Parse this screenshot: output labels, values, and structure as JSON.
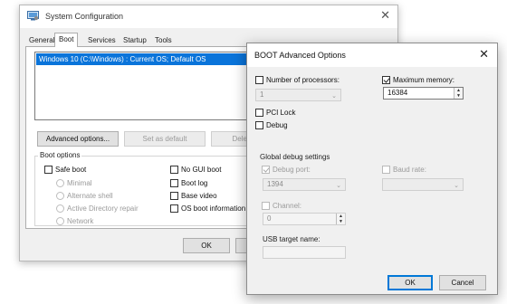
{
  "syscfg": {
    "title": "System Configuration",
    "tabs": [
      "General",
      "Boot",
      "Services",
      "Startup",
      "Tools"
    ],
    "os_entries": [
      "Windows 10 (C:\\Windows) : Current OS; Default OS"
    ],
    "buttons": {
      "advanced": "Advanced options...",
      "set_default": "Set as default",
      "delete": "Delete",
      "ok": "OK"
    },
    "boot_options": {
      "legend": "Boot options",
      "safe_boot": "Safe boot",
      "minimal": "Minimal",
      "alternate_shell": "Alternate shell",
      "active_directory_repair": "Active Directory repair",
      "network": "Network",
      "no_gui_boot": "No GUI boot",
      "boot_log": "Boot log",
      "base_video": "Base video",
      "os_boot_information": "OS boot information"
    }
  },
  "advanced": {
    "title": "BOOT Advanced Options",
    "num_processors": {
      "label": "Number of processors:",
      "checked": false,
      "value": "1"
    },
    "max_memory": {
      "label": "Maximum memory:",
      "checked": true,
      "value": "16384"
    },
    "pci_lock": {
      "label": "PCI Lock",
      "checked": false
    },
    "debug": {
      "label": "Debug",
      "checked": false
    },
    "global_debug": {
      "legend": "Global debug settings",
      "debug_port": {
        "label": "Debug port:",
        "checked": true,
        "value": "1394"
      },
      "baud_rate": {
        "label": "Baud rate:",
        "checked": false,
        "value": ""
      },
      "channel": {
        "label": "Channel:",
        "checked": false,
        "value": "0"
      },
      "usb_target_name": {
        "label": "USB target name:",
        "value": ""
      }
    },
    "buttons": {
      "ok": "OK",
      "cancel": "Cancel"
    }
  }
}
